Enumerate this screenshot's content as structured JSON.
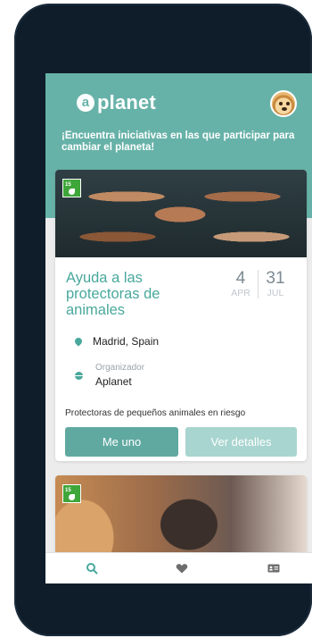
{
  "app": {
    "logo_text": "planet",
    "logo_mark": "a",
    "tagline": "¡Encuentra iniciativas en las que participar para cambiar el planeta!"
  },
  "colors": {
    "accent": "#67b2a8",
    "title": "#49a89c",
    "button_primary": "#5fa9a0",
    "button_secondary": "#a8d5cf",
    "device_frame": "#0f1d2b"
  },
  "initiatives": [
    {
      "title": "Ayuda a las protectoras de animales",
      "start_day": "4",
      "start_month": "APR",
      "end_day": "31",
      "end_month": "JUL",
      "location": "Madrid, Spain",
      "organizer_label": "Organizador",
      "organizer": "Aplanet",
      "description": "Protectoras de pequeños animales en riesgo",
      "join_label": "Me uno",
      "details_label": "Ver detalles",
      "badge_icon": "ods-goal-15-icon"
    },
    {
      "badge_icon": "ods-goal-15-icon"
    }
  ],
  "bottom_nav": {
    "items": [
      "search-icon",
      "heart-icon",
      "id-card-icon"
    ]
  }
}
